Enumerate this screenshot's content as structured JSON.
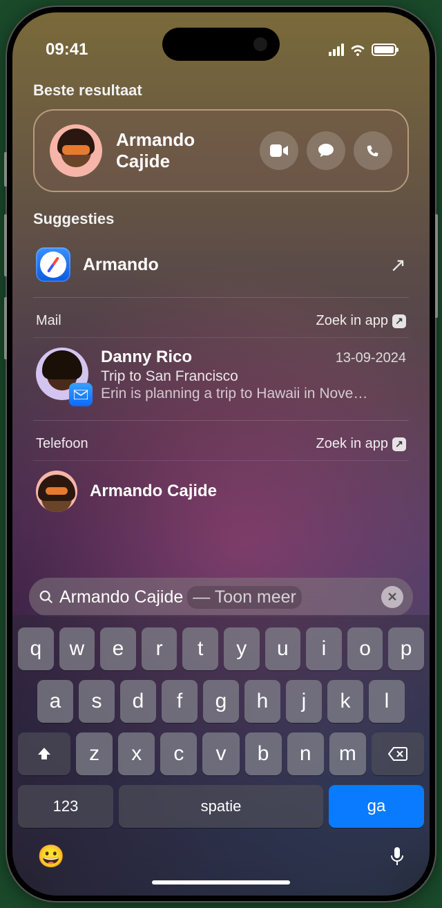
{
  "status": {
    "time": "09:41"
  },
  "bestResult": {
    "section": "Beste resultaat",
    "firstName": "Armando",
    "lastName": "Cajide"
  },
  "suggestions": {
    "section": "Suggesties",
    "first": "Armando"
  },
  "mail": {
    "section": "Mail",
    "searchInApp": "Zoek in app",
    "sender": "Danny Rico",
    "date": "13-09-2024",
    "subject": "Trip to San Francisco",
    "preview": "Erin is planning a trip to Hawaii in Nove…"
  },
  "phone": {
    "section": "Telefoon",
    "searchInApp": "Zoek in app",
    "name": "Armando Cajide"
  },
  "search": {
    "query": "Armando Cajide",
    "hint": "—  Toon meer"
  },
  "keyboard": {
    "row1": [
      "q",
      "w",
      "e",
      "r",
      "t",
      "y",
      "u",
      "i",
      "o",
      "p"
    ],
    "row2": [
      "a",
      "s",
      "d",
      "f",
      "g",
      "h",
      "j",
      "k",
      "l"
    ],
    "row3": [
      "z",
      "x",
      "c",
      "v",
      "b",
      "n",
      "m"
    ],
    "numKey": "123",
    "spaceKey": "spatie",
    "goKey": "ga"
  }
}
